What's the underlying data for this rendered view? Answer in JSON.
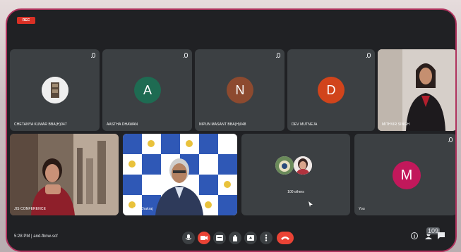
{
  "recording_label": "REC",
  "participants": [
    {
      "name": "CHETANYA KUMAR BBA(H)047"
    },
    {
      "name": "AASTHA DHAWAN",
      "initial": "A",
      "color": "#1e6b52"
    },
    {
      "name": "NIPUN MASANT BBA(H)048",
      "initial": "N",
      "color": "#8d4a2f"
    },
    {
      "name": "DEV MUTNEJA",
      "initial": "D",
      "color": "#d1441b"
    },
    {
      "name": "MITHVIR SINGH"
    },
    {
      "name": "JIS CONFERENCE"
    },
    {
      "name": "Dr. J.S. Chakraj"
    },
    {
      "name": "100 others"
    },
    {
      "name": "You",
      "initial": "M",
      "color": "#c2185b"
    }
  ],
  "bottom": {
    "time": "5:28 PM",
    "meeting_code": "and-fbnw-scf",
    "people_count": "109"
  },
  "colors": {
    "accent_border": "#b0335e",
    "tile_bg": "#3c4043",
    "end_call": "#ea4335"
  }
}
